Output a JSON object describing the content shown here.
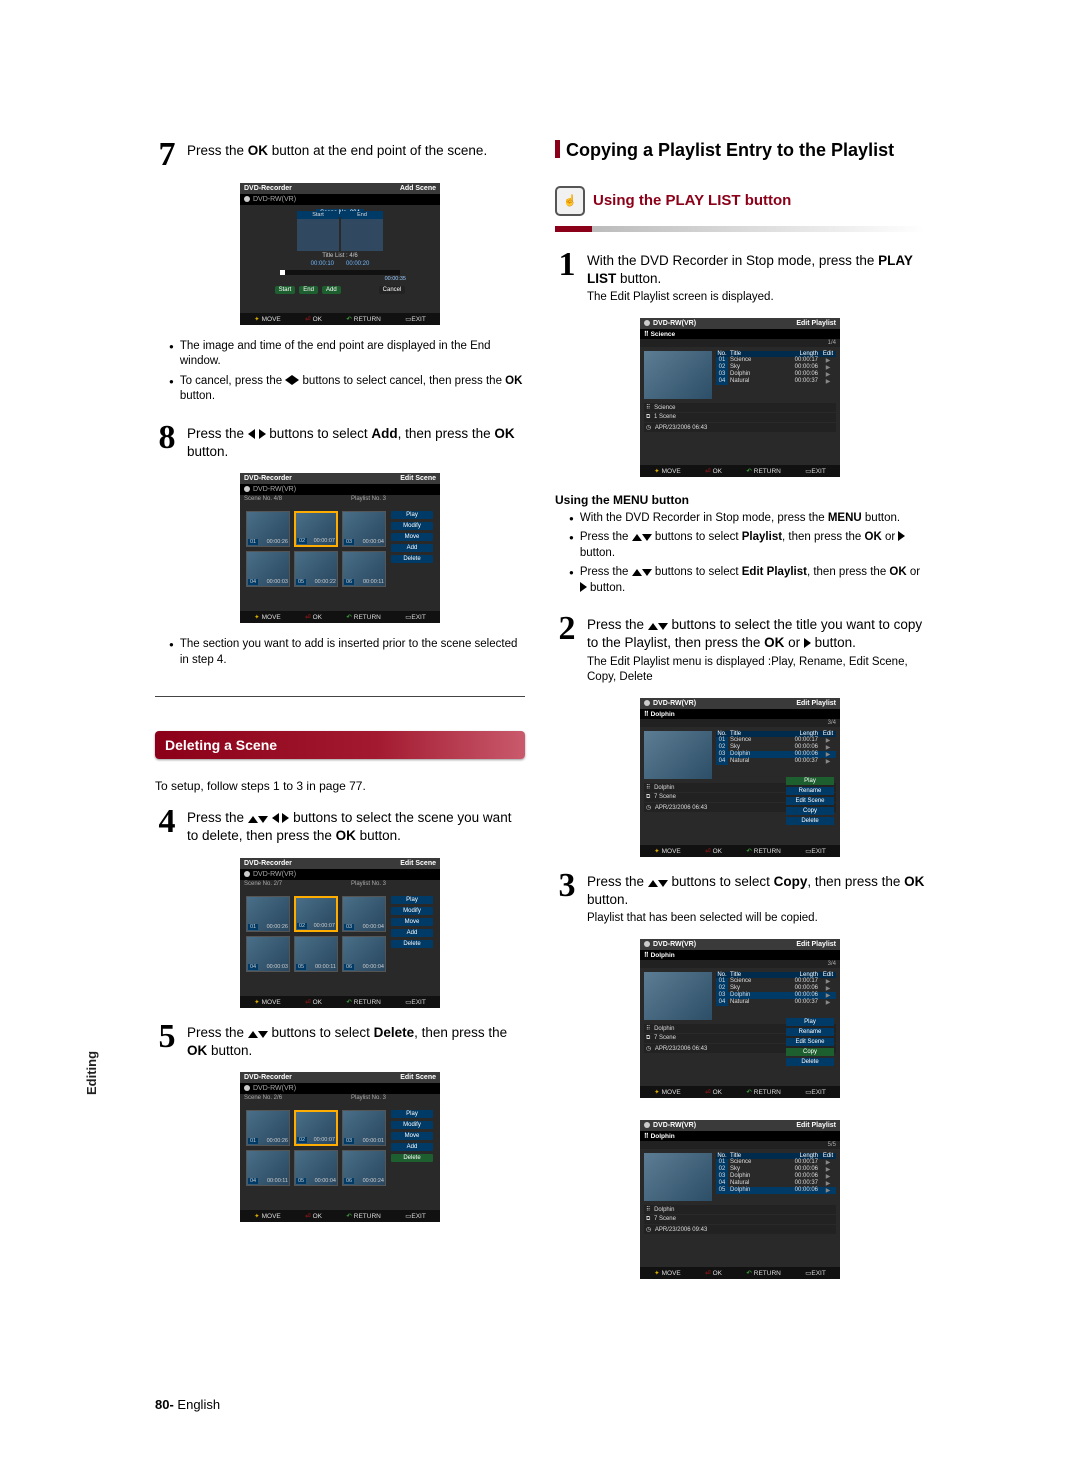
{
  "page": {
    "number": "80-",
    "lang": "English"
  },
  "side_label": "Editing",
  "left": {
    "step7": {
      "num": "7",
      "text_a": "Press the ",
      "ok": "OK",
      "text_b": " button at the end point of the scene."
    },
    "tv_addscene": {
      "title_l": "DVD-Recorder",
      "title_r": "Add Scene",
      "disc": "DVD-RW(VR)",
      "scene_no": "Scene No. 004",
      "lbl_start": "Start",
      "lbl_end": "End",
      "title_list": "Title List : 4/6",
      "time_l": "00:00:10",
      "time_r": "00:00:20",
      "bar_time": "00:00:35",
      "btns": [
        "Start",
        "End",
        "Add",
        "Cancel"
      ]
    },
    "notes7": [
      "The image and time of the end point are displayed in the End window.",
      "To cancel, press the ◀▶ buttons to select cancel, then press the OK button."
    ],
    "step8": {
      "num": "8",
      "text": "Press the ◀▶ buttons to select Add, then press the OK button.",
      "bold": [
        "Add",
        "OK"
      ]
    },
    "tv_editscene1": {
      "title_l": "DVD-Recorder",
      "title_r": "Edit Scene",
      "disc": "DVD-RW(VR)",
      "scene": "Scene No.    4/8",
      "playlist": "Playlist No. 3",
      "cells": [
        {
          "n": "01",
          "t": "00:00:26"
        },
        {
          "n": "02",
          "t": "00:00:07"
        },
        {
          "n": "03",
          "t": "00:00:04"
        },
        {
          "n": "04",
          "t": "00:00:03"
        },
        {
          "n": "05",
          "t": "00:00:22"
        },
        {
          "n": "06",
          "t": "00:00:11"
        }
      ],
      "menu": [
        "Play",
        "Modify",
        "Move",
        "Add",
        "Delete"
      ]
    },
    "note8": "The section you want to add is inserted prior to the scene selected in step 4.",
    "deleting_title": "Deleting a Scene",
    "setup_note": "To setup, follow steps 1 to 3 in page 77.",
    "step4": {
      "num": "4",
      "text": "Press the ▲▼ ◀▶ buttons to select the scene you want to delete, then press the OK button.",
      "bold": [
        "OK"
      ]
    },
    "tv_editscene2": {
      "title_l": "DVD-Recorder",
      "title_r": "Edit Scene",
      "disc": "DVD-RW(VR)",
      "scene": "Scene No.    2/7",
      "playlist": "Playlist No. 3",
      "cells": [
        {
          "n": "01",
          "t": "00:00:26"
        },
        {
          "n": "02",
          "t": "00:00:07"
        },
        {
          "n": "03",
          "t": "00:00:04"
        },
        {
          "n": "04",
          "t": "00:00:03"
        },
        {
          "n": "05",
          "t": "00:00:11"
        },
        {
          "n": "06",
          "t": "00:00:04"
        }
      ],
      "menu": [
        "Play",
        "Modify",
        "Move",
        "Add",
        "Delete"
      ]
    },
    "step5": {
      "num": "5",
      "text": "Press the ▲▼ buttons to select Delete, then press the OK button.",
      "bold": [
        "Delete",
        "OK"
      ]
    },
    "tv_editscene3": {
      "title_l": "DVD-Recorder",
      "title_r": "Edit Scene",
      "disc": "DVD-RW(VR)",
      "scene": "Scene No.    2/6",
      "playlist": "Playlist No. 3",
      "cells": [
        {
          "n": "01",
          "t": "00:00:26"
        },
        {
          "n": "02",
          "t": "00:00:07"
        },
        {
          "n": "03",
          "t": "00:00:01"
        },
        {
          "n": "04",
          "t": "00:00:11"
        },
        {
          "n": "05",
          "t": "00:00:04"
        },
        {
          "n": "06",
          "t": "00:00:24"
        }
      ],
      "menu": [
        "Play",
        "Modify",
        "Move",
        "Add",
        "Delete"
      ]
    }
  },
  "right": {
    "heading": "Copying a Playlist Entry to the Playlist",
    "playlist_heading": "Using the PLAY LIST button",
    "step1": {
      "num": "1",
      "text": "With the DVD Recorder in Stop mode, press the PLAY LIST button.",
      "sub": "The Edit Playlist screen is displayed.",
      "bold": [
        "PLAY LIST"
      ]
    },
    "tv_pl1": {
      "title_l": "DVD-RW(VR)",
      "title_r": "Edit Playlist",
      "cat": "Science",
      "pager": "1/4",
      "hdr": [
        "No.",
        "Title",
        "Length",
        "Edit"
      ],
      "rows": [
        {
          "n": "01",
          "t": "Science",
          "len": "00:00:17",
          "e": "▶"
        },
        {
          "n": "02",
          "t": "Sky",
          "len": "00:00:06",
          "e": "▶"
        },
        {
          "n": "03",
          "t": "Dolphin",
          "len": "00:00:06",
          "e": "▶"
        },
        {
          "n": "04",
          "t": "Natural",
          "len": "00:00:37",
          "e": "▶"
        }
      ],
      "meta": [
        "Science",
        "1 Scene",
        "APR/23/2006 06:43"
      ]
    },
    "menu_heading": "Using the MENU button",
    "menu_notes": [
      "With the DVD Recorder in Stop mode, press the MENU button.",
      "Press the ▲▼ buttons to select Playlist, then press the OK or ▶ button.",
      "Press the ▲▼ buttons to select Edit Playlist, then press the OK or ▶ button."
    ],
    "step2": {
      "num": "2",
      "text": "Press the ▲▼ buttons to select the title you want to copy to the Playlist, then press the OK or ▶ button.",
      "sub": "The Edit Playlist menu is displayed :Play, Rename, Edit Scene, Copy, Delete",
      "bold": [
        "OK"
      ]
    },
    "tv_pl2": {
      "title_l": "DVD-RW(VR)",
      "title_r": "Edit Playlist",
      "cat": "Dolphin",
      "pager": "3/4",
      "hdr": [
        "No.",
        "Title",
        "Length",
        "Edit"
      ],
      "rows": [
        {
          "n": "01",
          "t": "Science",
          "len": "00:00:17",
          "e": "▶"
        },
        {
          "n": "02",
          "t": "Sky",
          "len": "00:00:06",
          "e": "▶"
        },
        {
          "n": "03",
          "t": "Dolphin",
          "len": "00:00:06",
          "e": "▶"
        },
        {
          "n": "04",
          "t": "Natural",
          "len": "00:00:37",
          "e": "▶"
        }
      ],
      "drop": [
        "Play",
        "Rename",
        "Edit Scene",
        "Copy",
        "Delete"
      ],
      "meta": [
        "Dolphin",
        "7 Scene",
        "APR/23/2006 06:43"
      ]
    },
    "step3": {
      "num": "3",
      "text": "Press the ▲▼ buttons to select Copy, then press the OK button.",
      "sub": "Playlist that has been selected will be copied.",
      "bold": [
        "Copy",
        "OK"
      ]
    },
    "tv_pl3": {
      "title_l": "DVD-RW(VR)",
      "title_r": "Edit Playlist",
      "cat": "Dolphin",
      "pager": "3/4",
      "hdr": [
        "No.",
        "Title",
        "Length",
        "Edit"
      ],
      "rows": [
        {
          "n": "01",
          "t": "Science",
          "len": "00:00:17",
          "e": "▶"
        },
        {
          "n": "02",
          "t": "Sky",
          "len": "00:00:06",
          "e": "▶"
        },
        {
          "n": "03",
          "t": "Dolphin",
          "len": "00:00:06",
          "e": "▶"
        },
        {
          "n": "04",
          "t": "Natural",
          "len": "00:00:37",
          "e": "▶"
        }
      ],
      "drop": [
        "Play",
        "Rename",
        "Edit Scene",
        "Copy",
        "Delete"
      ],
      "meta": [
        "Dolphin",
        "7 Scene",
        "APR/23/2006 06:43"
      ]
    },
    "tv_pl4": {
      "title_l": "DVD-RW(VR)",
      "title_r": "Edit Playlist",
      "cat": "Dolphin",
      "pager": "5/5",
      "hdr": [
        "No.",
        "Title",
        "Length",
        "Edit"
      ],
      "rows": [
        {
          "n": "01",
          "t": "Science",
          "len": "00:00:17",
          "e": "▶"
        },
        {
          "n": "02",
          "t": "Sky",
          "len": "00:00:06",
          "e": "▶"
        },
        {
          "n": "03",
          "t": "Dolphin",
          "len": "00:00:06",
          "e": "▶"
        },
        {
          "n": "04",
          "t": "Natural",
          "len": "00:00:37",
          "e": "▶"
        },
        {
          "n": "05",
          "t": "Dolphin",
          "len": "00:00:06",
          "e": "▶"
        }
      ],
      "meta": [
        "Dolphin",
        "7 Scene",
        "APR/23/2006 09:43"
      ]
    }
  },
  "footer": {
    "move": "MOVE",
    "ok": "OK",
    "return": "RETURN",
    "exit": "EXIT"
  }
}
